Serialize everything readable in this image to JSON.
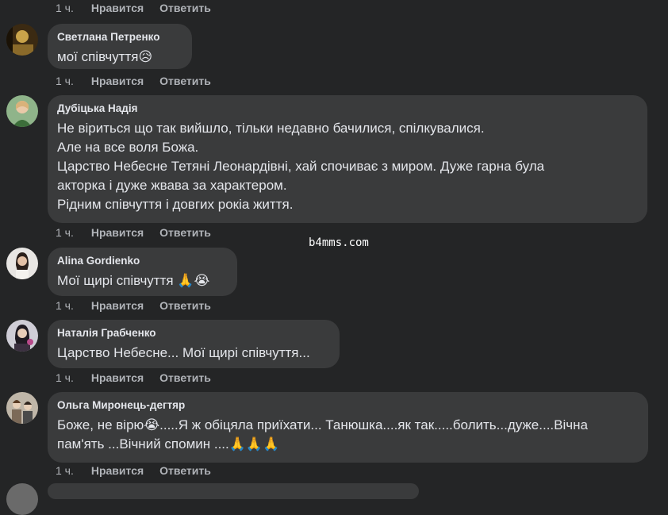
{
  "actions_labels": {
    "time": "1 ч.",
    "like": "Нравится",
    "reply": "Ответить"
  },
  "comments": [
    {
      "author": "Светлана Петренко",
      "text": "мої співчуття😥"
    },
    {
      "author": "Дубіцька Надія",
      "text": "Не віриться що так вийшло, тільки недавно бачилися, спілкувалися.\nАле на все воля Божа.\nЦарство Небесне Тетяні Леонардівні, хай спочиває з миром. Дуже гарна була\nакторка і дуже жвава за характером.\nРідним співчуття і довгих рокіа життя."
    },
    {
      "author": "Alina Gordienko",
      "text": "Мої щирі співчуття 🙏😭"
    },
    {
      "author": "Наталія Грабченко",
      "text": "Царство Небесне... Мої щирі співчуття..."
    },
    {
      "author": "Ольга Миронець-дегтяр",
      "text": "Боже, не вірю😭.....Я ж обіцяла приїхати... Танюшка....як так.....болить...дуже....Вічна\nпам'ять ...Вічний спомин ....🙏🙏🙏"
    }
  ],
  "watermark": "b4mms.com",
  "colors": {
    "background": "#242526",
    "bubble": "#3a3b3c",
    "text": "#e4e6eb",
    "muted": "#b0b3b8"
  }
}
